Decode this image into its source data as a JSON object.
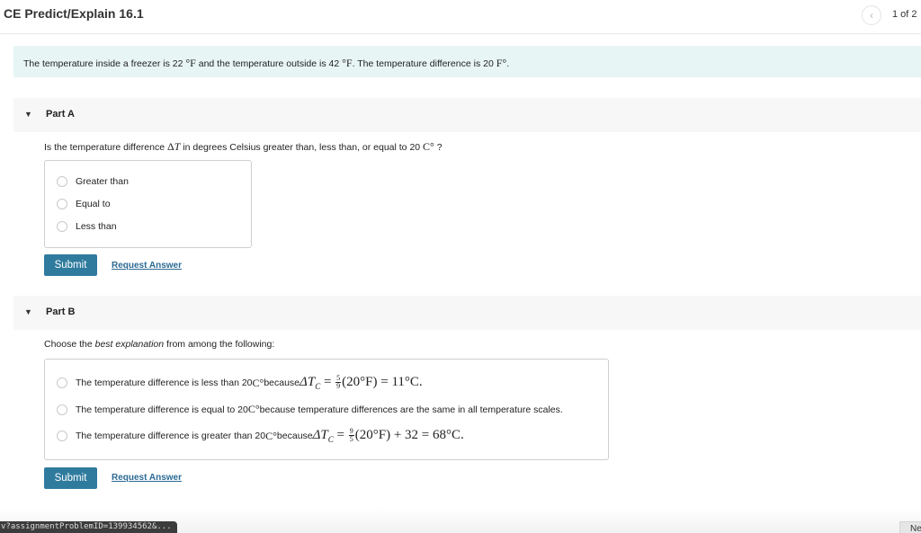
{
  "header": {
    "title": "CE Predict/Explain 16.1",
    "prev_icon": "‹",
    "page_indicator": "1 of 2"
  },
  "intro": {
    "t1": "The temperature inside a freezer is 22 ",
    "m1": "°F",
    "t2": " and the temperature outside is 42 ",
    "m2": "°F",
    "t3": ". The temperature difference is 20 ",
    "m3": "F°",
    "t4": "."
  },
  "part_a": {
    "label": "Part A",
    "toggle_icon": "▼",
    "question": {
      "t1": "Is the temperature difference ",
      "delta": "Δ",
      "var": "T",
      "t2": " in degrees Celsius greater than, less than, or equal to 20 ",
      "unit": "C°",
      "t3": " ?"
    },
    "options": [
      "Greater than",
      "Equal to",
      "Less than"
    ],
    "submit_label": "Submit",
    "request_label": "Request Answer"
  },
  "part_b": {
    "label": "Part B",
    "toggle_icon": "▼",
    "question": {
      "t1": "Choose the ",
      "em": "best explanation",
      "t2": " from among the following:"
    },
    "options": [
      {
        "text": "The temperature difference is less than 20 ",
        "unit": "C°",
        "because": " because ",
        "lhs": "ΔT",
        "sub": "C",
        "eq": " = ",
        "num": "5",
        "den": "9",
        "rest": "(20°F) = 11°C."
      },
      {
        "text": "The temperature difference is equal to 20 ",
        "unit": "C°",
        "tail": " because temperature differences are the same in all temperature scales."
      },
      {
        "text": "The temperature difference is greater than 20 ",
        "unit": "C°",
        "because": " because ",
        "lhs": "ΔT",
        "sub": "C",
        "eq": " = ",
        "num": "9",
        "den": "5",
        "rest": "(20°F) + 32 = 68°C."
      }
    ],
    "submit_label": "Submit",
    "request_label": "Request Answer"
  },
  "status_bar": {
    "url": "v?assignmentProblemID=139934562&...",
    "next_label": "Next"
  }
}
